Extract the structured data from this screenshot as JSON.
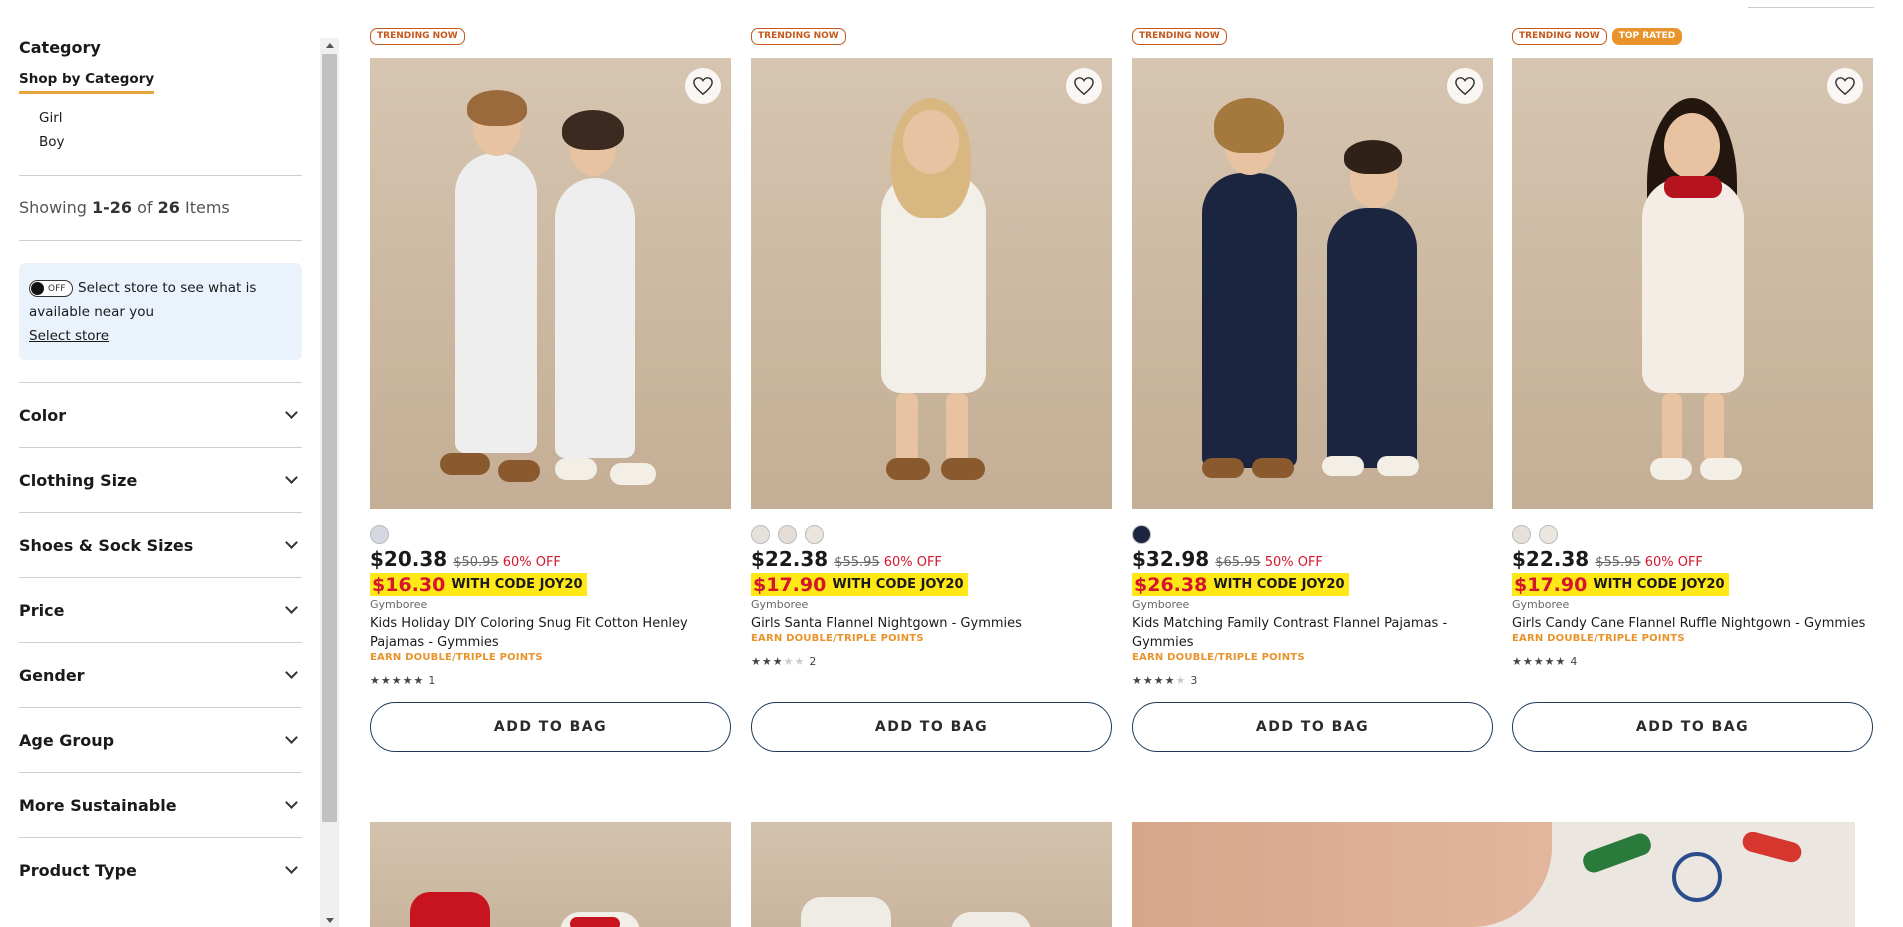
{
  "sidebar": {
    "category_title": "Category",
    "shop_by": "Shop by Category",
    "categories": [
      "Girl",
      "Boy"
    ],
    "showing": {
      "prefix": "Showing ",
      "range": "1-26",
      "of": " of ",
      "total": "26",
      "suffix": " Items"
    },
    "store": {
      "toggle_state": "OFF",
      "text": "Select store to see what is available near you",
      "link": "Select store"
    },
    "facets": [
      "Color",
      "Clothing Size",
      "Shoes & Sock Sizes",
      "Price",
      "Gender",
      "Age Group",
      "More Sustainable",
      "Product Type"
    ]
  },
  "products": [
    {
      "badges": [
        "TRENDING NOW"
      ],
      "top_badge": "",
      "swatches": [
        "#d4d8e2"
      ],
      "price": "$20.38",
      "was": "$50.95",
      "pct": "60% OFF",
      "code_price": "$16.30",
      "code_text": "WITH CODE JOY20",
      "brand": "Gymboree",
      "name": "Kids Holiday DIY Coloring Snug Fit Cotton Henley Pajamas - Gymmies",
      "earn": "EARN DOUBLE/TRIPLE POINTS",
      "stars": 5,
      "reviews": "1",
      "button": "ADD TO BAG"
    },
    {
      "badges": [
        "TRENDING NOW"
      ],
      "top_badge": "",
      "swatches": [
        "#e6e1da",
        "#e3ddd5",
        "#e9e4dc"
      ],
      "price": "$22.38",
      "was": "$55.95",
      "pct": "60% OFF",
      "code_price": "$17.90",
      "code_text": "WITH CODE JOY20",
      "brand": "Gymboree",
      "name": "Girls Santa Flannel Nightgown - Gymmies",
      "earn": "EARN DOUBLE/TRIPLE POINTS",
      "stars": 3,
      "reviews": "2",
      "button": "ADD TO BAG"
    },
    {
      "badges": [
        "TRENDING NOW"
      ],
      "top_badge": "",
      "swatches": [
        "#1b2540"
      ],
      "price": "$32.98",
      "was": "$65.95",
      "pct": "50% OFF",
      "code_price": "$26.38",
      "code_text": "WITH CODE JOY20",
      "brand": "Gymboree",
      "name": "Kids Matching Family Contrast Flannel Pajamas - Gymmies",
      "earn": "EARN DOUBLE/TRIPLE POINTS",
      "stars": 4,
      "reviews": "3",
      "button": "ADD TO BAG"
    },
    {
      "badges": [
        "TRENDING NOW"
      ],
      "top_badge": "TOP RATED",
      "swatches": [
        "#e6e1da",
        "#ebe6df"
      ],
      "price": "$22.38",
      "was": "$55.95",
      "pct": "60% OFF",
      "code_price": "$17.90",
      "code_text": "WITH CODE JOY20",
      "brand": "Gymboree",
      "name": "Girls Candy Cane Flannel Ruffle Nightgown - Gymmies",
      "earn": "EARN DOUBLE/TRIPLE POINTS",
      "stars": 5,
      "reviews": "4",
      "button": "ADD TO BAG"
    }
  ],
  "colors": {
    "accent_underline": "#e8a33d",
    "sale_red": "#d4162c",
    "code_yellow": "#ffe816",
    "points_orange": "#e8932b",
    "trend_orange": "#c5581c",
    "button_border": "#1e3b5a"
  }
}
